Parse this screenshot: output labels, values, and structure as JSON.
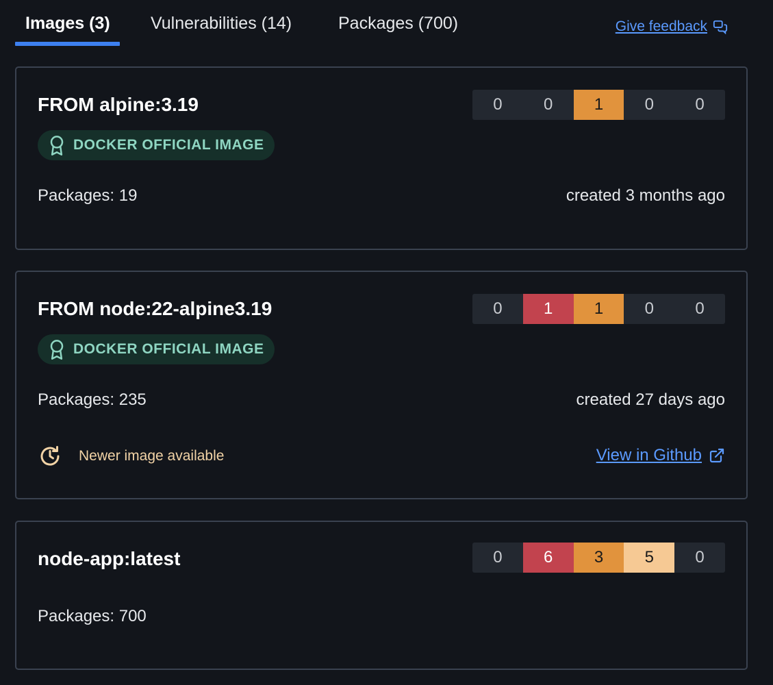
{
  "tabs": [
    {
      "label": "Images (3)"
    },
    {
      "label": "Vulnerabilities (14)"
    },
    {
      "label": "Packages (700)"
    }
  ],
  "feedback_label": "Give feedback",
  "colors": {
    "critical": "#c2434e",
    "high": "#e1933d",
    "medium": "#f6c994",
    "neutral": "#232830",
    "accent": "#3d80f0",
    "link": "#5b9aff"
  },
  "cards": [
    {
      "title": "FROM alpine:3.19",
      "badge": "DOCKER OFFICIAL IMAGE",
      "severity": [
        "0",
        "0",
        "1",
        "0",
        "0"
      ],
      "packages": "Packages: 19",
      "created": "created 3 months ago"
    },
    {
      "title": "FROM node:22-alpine3.19",
      "badge": "DOCKER OFFICIAL IMAGE",
      "severity": [
        "0",
        "1",
        "1",
        "0",
        "0"
      ],
      "packages": "Packages: 235",
      "created": "created 27 days ago",
      "newer": "Newer image available",
      "github_link": "View in Github"
    },
    {
      "title": "node-app:latest",
      "severity": [
        "0",
        "6",
        "3",
        "5",
        "0"
      ],
      "packages": "Packages: 700"
    }
  ]
}
